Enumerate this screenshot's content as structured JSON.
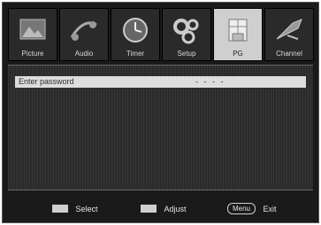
{
  "tabs": [
    {
      "label": "Picture",
      "icon": "picture-icon",
      "active": false
    },
    {
      "label": "Audio",
      "icon": "audio-icon",
      "active": false
    },
    {
      "label": "Timer",
      "icon": "timer-icon",
      "active": false
    },
    {
      "label": "Setup",
      "icon": "setup-icon",
      "active": false
    },
    {
      "label": "PG",
      "icon": "pg-icon",
      "active": true
    },
    {
      "label": "Channel",
      "icon": "channel-icon",
      "active": false
    }
  ],
  "menu": {
    "password_label": "Enter password",
    "password_value": "- - - -"
  },
  "footer": {
    "select": {
      "label": "Select",
      "icon": "updown-arrows-icon"
    },
    "adjust": {
      "label": "Adjust",
      "icon": "leftright-arrows-icon"
    },
    "exit": {
      "key": "Menu",
      "label": "Exit"
    }
  },
  "colors": {
    "screen_bg": "#1a1a1a",
    "panel_bg": "#2b2b2b",
    "highlight": "#dcdcdc",
    "active_tab": "#cfcfcf"
  }
}
